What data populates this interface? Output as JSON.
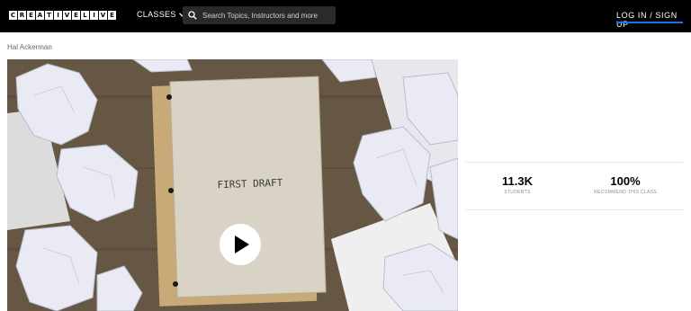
{
  "header": {
    "logo_letters": [
      "C",
      "R",
      "E",
      "A",
      "T",
      "I",
      "V",
      "E",
      "L",
      "I",
      "V",
      "E"
    ],
    "classes_label": "CLASSES",
    "search_placeholder": "Search Topics, Instructors and more",
    "login_label": "LOG IN / SIGN UP",
    "login_accent_color": "#1a73e8"
  },
  "instructor": "Hal Ackerman",
  "video": {
    "thumbnail_text": "FIRST DRAFT",
    "play_icon": "play-icon"
  },
  "stats": [
    {
      "value": "11.3K",
      "label": "STUDENTS"
    },
    {
      "value": "100%",
      "label": "RECOMMEND THIS CLASS"
    }
  ]
}
